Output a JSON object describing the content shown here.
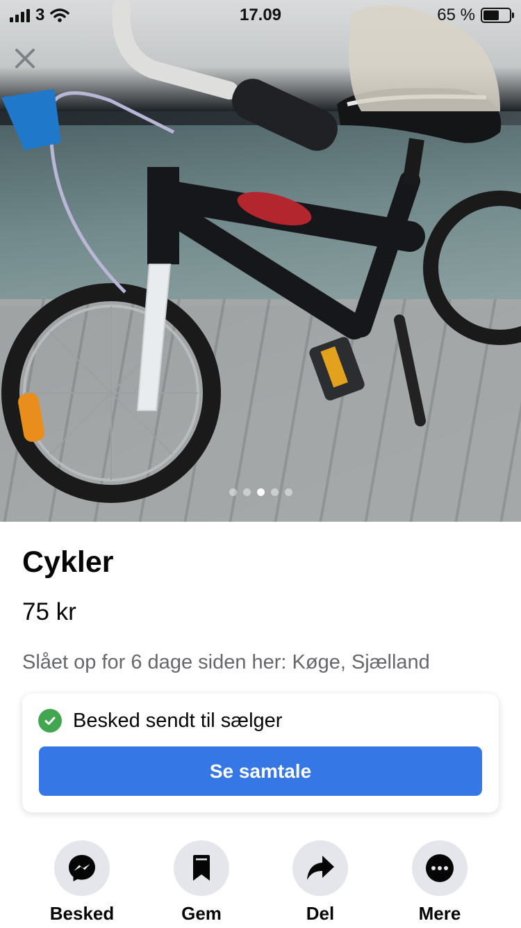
{
  "status_bar": {
    "carrier": "3",
    "time": "17.09",
    "battery": "65 %"
  },
  "photo": {
    "slide_count": 5,
    "active_slide": 3
  },
  "listing": {
    "title": "Cykler",
    "price": "75 kr",
    "meta": "Slået op for 6 dage siden her: Køge, Sjælland"
  },
  "message_card": {
    "status": "Besked sendt til sælger",
    "button": "Se samtale"
  },
  "actions": [
    {
      "label": "Besked",
      "icon": "messenger-icon"
    },
    {
      "label": "Gem",
      "icon": "bookmark-icon"
    },
    {
      "label": "Del",
      "icon": "share-icon"
    },
    {
      "label": "Mere",
      "icon": "more-icon"
    }
  ],
  "colors": {
    "primary_button": "#3578e5",
    "check": "#42a650",
    "secondary_text": "#65676b",
    "action_circle": "#e4e6eb"
  }
}
